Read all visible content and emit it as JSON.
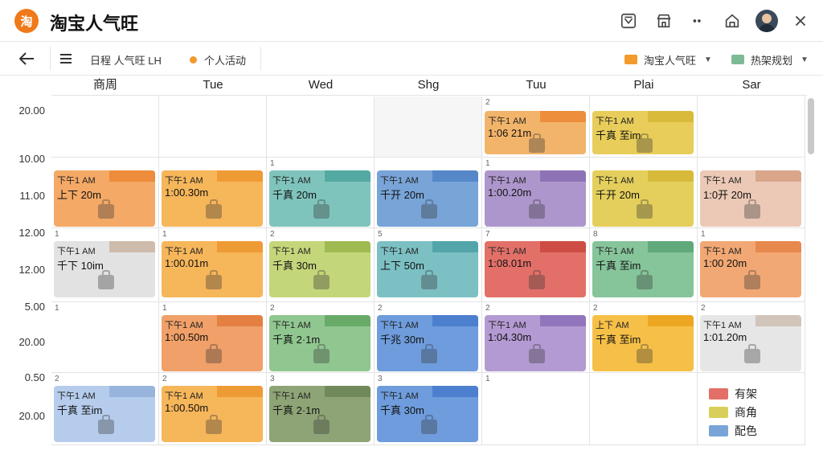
{
  "app": {
    "logo_text": "淘",
    "title": "淘宝人气旺"
  },
  "toolbar": {
    "view_label": "日程 人气旺 LH",
    "status_label": "个人活动",
    "filter1": {
      "label": "淘宝人气旺",
      "color": "#f39a2c"
    },
    "filter2": {
      "label": "热架规划",
      "color": "#7dbb96"
    }
  },
  "days": [
    "商周",
    "Tue",
    "Wed",
    "Shg",
    "Tuu",
    "Plai",
    "Sar"
  ],
  "times": [
    "20.00",
    "10.00",
    "11.00",
    "12.00",
    "12.00",
    "5.00",
    "20.00",
    "0.50",
    "20.00"
  ],
  "rows": [
    {
      "cells": [
        {
          "num": "",
          "shade": false,
          "event": null
        },
        {
          "num": "",
          "shade": false,
          "event": null
        },
        {
          "num": "",
          "shade": false,
          "event": null
        },
        {
          "num": "",
          "shade": true,
          "event": null
        },
        {
          "num": "2",
          "shade": false,
          "event": {
            "t1": "下午1 AM",
            "t2": "1:06 21m",
            "color": "#f2b46a",
            "bar": "#ec8c3a"
          }
        },
        {
          "num": "",
          "shade": false,
          "event": {
            "t1": "下午1 AM",
            "t2": "千真 至im",
            "color": "#e8cd5a",
            "bar": "#d8b83a"
          }
        },
        {
          "num": "",
          "shade": false,
          "event": null
        }
      ]
    },
    {
      "cells": [
        {
          "num": "",
          "shade": false,
          "event": {
            "t1": "下午1 AM",
            "t2": "上下 20m",
            "color": "#f4a966",
            "bar": "#ec8a38"
          }
        },
        {
          "num": "",
          "shade": false,
          "event": {
            "t1": "下午1 AM",
            "t2": "1:00.30m",
            "color": "#f6b65a",
            "bar": "#ee9a34"
          }
        },
        {
          "num": "1",
          "shade": false,
          "event": {
            "t1": "下午1 AM",
            "t2": "千真 20m",
            "color": "#7fc4bc",
            "bar": "#52a9a0"
          }
        },
        {
          "num": "",
          "shade": false,
          "event": {
            "t1": "下午1 AM",
            "t2": "千开 20m",
            "color": "#78a4d8",
            "bar": "#5486c8"
          }
        },
        {
          "num": "1",
          "shade": false,
          "event": {
            "t1": "下午1 AM",
            "t2": "1:00.20m",
            "color": "#ad96cc",
            "bar": "#8c70b4"
          }
        },
        {
          "num": "",
          "shade": false,
          "event": {
            "t1": "下午1 AM",
            "t2": "千开 20m",
            "color": "#e4cf5c",
            "bar": "#d6b838"
          }
        },
        {
          "num": "",
          "shade": false,
          "event": {
            "t1": "下午1 AM",
            "t2": "1:0开 20m",
            "color": "#ecc9b6",
            "bar": "#d8a488"
          }
        }
      ]
    },
    {
      "cells": [
        {
          "num": "1",
          "shade": false,
          "event": {
            "t1": "下午1 AM",
            "t2": "千下 10im",
            "color": "#e2e2e2",
            "bar": "#cdb8a8"
          }
        },
        {
          "num": "1",
          "shade": false,
          "event": {
            "t1": "下午1 AM",
            "t2": "1:00.01m",
            "color": "#f6b65a",
            "bar": "#ee9a34"
          }
        },
        {
          "num": "2",
          "shade": false,
          "event": {
            "t1": "下午1 AM",
            "t2": "千真 30m",
            "color": "#c4d67a",
            "bar": "#9eb850"
          }
        },
        {
          "num": "5",
          "shade": false,
          "event": {
            "t1": "下午1 AM",
            "t2": "上下 50m",
            "color": "#7cc0c4",
            "bar": "#50a4a8"
          }
        },
        {
          "num": "7",
          "shade": false,
          "event": {
            "t1": "下午1 AM",
            "t2": "1:08.01m",
            "color": "#e27068",
            "bar": "#cc4a42"
          }
        },
        {
          "num": "8",
          "shade": false,
          "event": {
            "t1": "下午1 AM",
            "t2": "千真 至im",
            "color": "#86c49a",
            "bar": "#5ea878"
          }
        },
        {
          "num": "1",
          "shade": false,
          "event": {
            "t1": "下午1 AM",
            "t2": "1:00 20m",
            "color": "#f2a874",
            "bar": "#e6864a"
          }
        }
      ]
    },
    {
      "cells": [
        {
          "num": "1",
          "shade": false,
          "event": null
        },
        {
          "num": "1",
          "shade": false,
          "event": {
            "t1": "下午1 AM",
            "t2": "1:00.50m",
            "color": "#f0a068",
            "bar": "#e27e40"
          }
        },
        {
          "num": "2",
          "shade": false,
          "event": {
            "t1": "下午1 AM",
            "t2": "千真 2·1m",
            "color": "#90c690",
            "bar": "#66aa66"
          }
        },
        {
          "num": "2",
          "shade": false,
          "event": {
            "t1": "下午1 AM",
            "t2": "千兆 30m",
            "color": "#6e9cdc",
            "bar": "#4a7ecc"
          }
        },
        {
          "num": "2",
          "shade": false,
          "event": {
            "t1": "下午1 AM",
            "t2": "1:04.30m",
            "color": "#b49ad2",
            "bar": "#9074bc"
          }
        },
        {
          "num": "2",
          "shade": false,
          "event": {
            "t1": "上下 AM",
            "t2": "千真 至im",
            "color": "#f6c048",
            "bar": "#eca420"
          }
        },
        {
          "num": "2",
          "shade": false,
          "event": {
            "t1": "下午1 AM",
            "t2": "1:01.20m",
            "color": "#e6e6e6",
            "bar": "#d0c2b6"
          }
        }
      ]
    },
    {
      "cells": [
        {
          "num": "2",
          "shade": false,
          "event": {
            "t1": "下午1 AM",
            "t2": "千真 至im",
            "color": "#b6ccec",
            "bar": "#96b2dc"
          }
        },
        {
          "num": "2",
          "shade": false,
          "event": {
            "t1": "下午1 AM",
            "t2": "1:00.50m",
            "color": "#f6b65a",
            "bar": "#ee9a34"
          }
        },
        {
          "num": "3",
          "shade": false,
          "event": {
            "t1": "下午1 AM",
            "t2": "千真 2·1m",
            "color": "#8ea476",
            "bar": "#6e8858"
          }
        },
        {
          "num": "3",
          "shade": false,
          "event": {
            "t1": "下午1 AM",
            "t2": "千真 30m",
            "color": "#6e9cdc",
            "bar": "#4a7ecc"
          }
        },
        {
          "num": "1",
          "shade": false,
          "event": null
        },
        {
          "num": "",
          "shade": false,
          "event": null
        },
        {
          "num": "",
          "shade": false,
          "event": null
        }
      ]
    }
  ],
  "legend": [
    {
      "label": "有架",
      "color": "#e27068"
    },
    {
      "label": "商角",
      "color": "#d8cf5a"
    },
    {
      "label": "配色",
      "color": "#78a4d8"
    }
  ]
}
